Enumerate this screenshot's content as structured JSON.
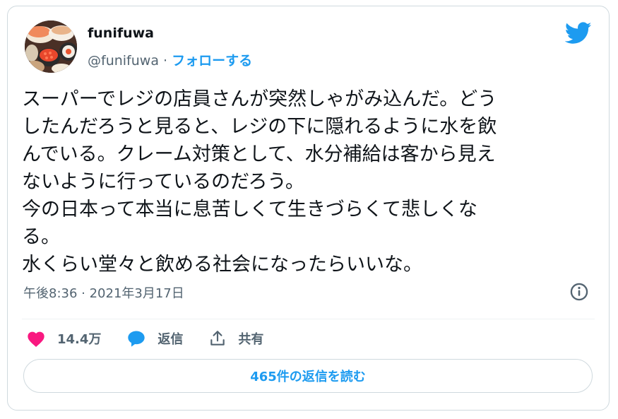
{
  "author": {
    "display_name": "funifuwa",
    "handle": "@funifuwa",
    "separator": " · ",
    "follow_label": "フォローする"
  },
  "tweet": {
    "text": "スーパーでレジの店員さんが突然しゃがみ込んだ。どう\nしたんだろうと見ると、レジの下に隠れるように水を飲\nんでいる。クレーム対策として、水分補給は客から見え\nないように行っているのだろう。\n今の日本って本当に息苦しくて生きづらくて悲しくな\nる。\n水くらい堂々と飲める社会になったらいいな。",
    "timestamp": "午後8:36 · 2021年3月17日"
  },
  "actions": {
    "like_count": "14.4万",
    "reply_label": "返信",
    "share_label": "共有"
  },
  "read_replies_label": "465件の返信を読む",
  "colors": {
    "accent": "#1d9bf0",
    "like": "#f91880",
    "muted": "#536471",
    "border": "#cfd9de"
  },
  "icons": {
    "logo": "twitter-bird-icon",
    "info": "info-circle-icon",
    "like": "heart-icon",
    "reply": "speech-bubble-icon",
    "share": "share-upload-icon"
  }
}
